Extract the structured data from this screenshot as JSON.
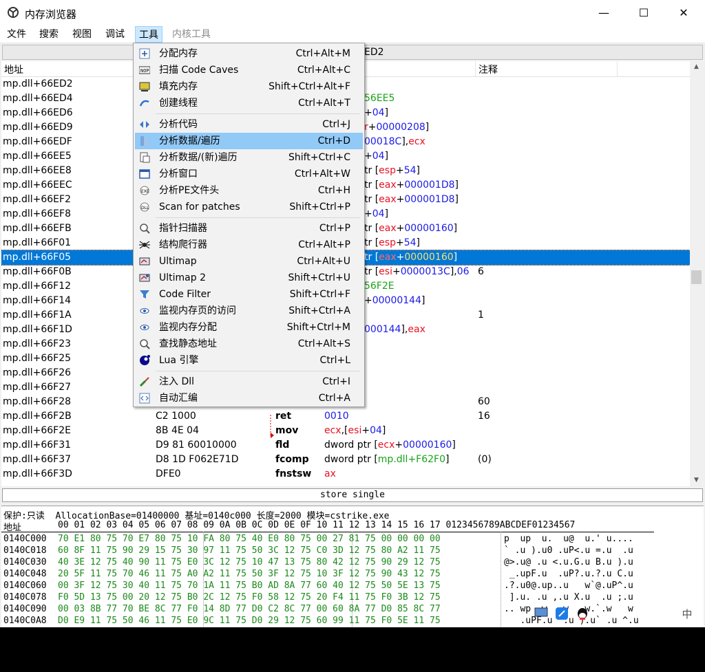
{
  "window": {
    "title": "内存浏览器",
    "buttons": {
      "minimize": "—",
      "maximize": "☐",
      "close": "✕"
    }
  },
  "menubar": [
    {
      "label": "文件"
    },
    {
      "label": "搜索"
    },
    {
      "label": "视图"
    },
    {
      "label": "调试"
    },
    {
      "label": "工具"
    },
    {
      "label": "内核工具"
    }
  ],
  "address_bar": {
    "value": "ED2"
  },
  "columns": {
    "address": "地址",
    "comment": "注释"
  },
  "disasm_rows": [
    {
      "addr": "mp.dll+66ED2"
    },
    {
      "addr": "mp.dll+66ED4",
      "operands": [
        {
          "t": "56EE5",
          "c": "sym"
        }
      ]
    },
    {
      "addr": "mp.dll+66ED6",
      "operands": [
        {
          "t": "+",
          "c": ""
        },
        {
          "t": "04",
          "c": "num"
        },
        {
          "t": "]",
          "c": ""
        }
      ]
    },
    {
      "addr": "mp.dll+66ED9",
      "operands": [
        {
          "t": "r",
          "c": "reg"
        },
        {
          "t": "+",
          "c": ""
        },
        {
          "t": "00000208",
          "c": "num"
        },
        {
          "t": "]",
          "c": ""
        }
      ]
    },
    {
      "addr": "mp.dll+66EDF",
      "operands": [
        {
          "t": "00018C",
          "c": "num"
        },
        {
          "t": "],",
          "c": ""
        },
        {
          "t": "ecx",
          "c": "reg"
        }
      ]
    },
    {
      "addr": "mp.dll+66EE5",
      "operands": [
        {
          "t": "+",
          "c": ""
        },
        {
          "t": "04",
          "c": "num"
        },
        {
          "t": "]",
          "c": ""
        }
      ]
    },
    {
      "addr": "mp.dll+66EE8",
      "operands": [
        {
          "t": "tr [",
          "c": ""
        },
        {
          "t": "esp",
          "c": "reg"
        },
        {
          "t": "+",
          "c": ""
        },
        {
          "t": "54",
          "c": "num"
        },
        {
          "t": "]",
          "c": ""
        }
      ]
    },
    {
      "addr": "mp.dll+66EEC",
      "operands": [
        {
          "t": "tr [",
          "c": ""
        },
        {
          "t": "eax",
          "c": "reg"
        },
        {
          "t": "+",
          "c": ""
        },
        {
          "t": "000001D8",
          "c": "num"
        },
        {
          "t": "]",
          "c": ""
        }
      ]
    },
    {
      "addr": "mp.dll+66EF2",
      "operands": [
        {
          "t": "tr [",
          "c": ""
        },
        {
          "t": "eax",
          "c": "reg"
        },
        {
          "t": "+",
          "c": ""
        },
        {
          "t": "000001D8",
          "c": "num"
        },
        {
          "t": "]",
          "c": ""
        }
      ]
    },
    {
      "addr": "mp.dll+66EF8",
      "operands": [
        {
          "t": "+",
          "c": ""
        },
        {
          "t": "04",
          "c": "num"
        },
        {
          "t": "]",
          "c": ""
        }
      ]
    },
    {
      "addr": "mp.dll+66EFB",
      "operands": [
        {
          "t": "tr [",
          "c": ""
        },
        {
          "t": "eax",
          "c": "reg"
        },
        {
          "t": "+",
          "c": ""
        },
        {
          "t": "00000160",
          "c": "num"
        },
        {
          "t": "]",
          "c": ""
        }
      ]
    },
    {
      "addr": "mp.dll+66F01",
      "operands": [
        {
          "t": "tr [",
          "c": ""
        },
        {
          "t": "esp",
          "c": "reg"
        },
        {
          "t": "+",
          "c": ""
        },
        {
          "t": "54",
          "c": "num"
        },
        {
          "t": "]",
          "c": ""
        }
      ]
    },
    {
      "addr": "mp.dll+66F05",
      "selected": true,
      "operands": [
        {
          "t": "tr [",
          "c": ""
        },
        {
          "t": "eax",
          "c": "reg"
        },
        {
          "t": "+",
          "c": ""
        },
        {
          "t": "00000160",
          "c": "num"
        },
        {
          "t": "]",
          "c": ""
        }
      ]
    },
    {
      "addr": "mp.dll+66F0B",
      "operands": [
        {
          "t": "tr [",
          "c": ""
        },
        {
          "t": "esi",
          "c": "reg"
        },
        {
          "t": "+",
          "c": ""
        },
        {
          "t": "0000013C",
          "c": "num"
        },
        {
          "t": "],",
          "c": ""
        },
        {
          "t": "06",
          "c": "num"
        }
      ],
      "comment": "6"
    },
    {
      "addr": "mp.dll+66F12",
      "operands": [
        {
          "t": "56F2E",
          "c": "sym"
        }
      ]
    },
    {
      "addr": "mp.dll+66F14",
      "operands": [
        {
          "t": "+",
          "c": ""
        },
        {
          "t": "00000144",
          "c": "num"
        },
        {
          "t": "]",
          "c": ""
        }
      ]
    },
    {
      "addr": "mp.dll+66F1A",
      "comment": "1"
    },
    {
      "addr": "mp.dll+66F1D",
      "operands": [
        {
          "t": "000144",
          "c": "num"
        },
        {
          "t": "],",
          "c": ""
        },
        {
          "t": "eax",
          "c": "reg"
        }
      ]
    },
    {
      "addr": "mp.dll+66F23"
    },
    {
      "addr": "mp.dll+66F25"
    },
    {
      "addr": "mp.dll+66F26"
    },
    {
      "addr": "mp.dll+66F27"
    },
    {
      "addr": "mp.dll+66F28",
      "comment": "60"
    },
    {
      "addr": "mp.dll+66F2B",
      "bytes": "C2 1000",
      "mnemonic": "ret",
      "operands": [
        {
          "t": "0010",
          "c": "num"
        }
      ],
      "comment": "16"
    },
    {
      "addr": "mp.dll+66F2E",
      "bytes": "8B 4E 04",
      "mnemonic": "mov",
      "operands": [
        {
          "t": "ecx",
          "c": "reg"
        },
        {
          "t": ",[",
          "c": ""
        },
        {
          "t": "esi",
          "c": "reg"
        },
        {
          "t": "+",
          "c": ""
        },
        {
          "t": "04",
          "c": "num"
        },
        {
          "t": "]",
          "c": ""
        }
      ]
    },
    {
      "addr": "mp.dll+66F31",
      "bytes": "D9 81 60010000",
      "mnemonic": "fld",
      "operands": [
        {
          "t": "dword ptr [",
          "c": ""
        },
        {
          "t": "ecx",
          "c": "reg"
        },
        {
          "t": "+",
          "c": ""
        },
        {
          "t": "00000160",
          "c": "num"
        },
        {
          "t": "]",
          "c": ""
        }
      ]
    },
    {
      "addr": "mp.dll+66F37",
      "bytes": "D8 1D F062E71D",
      "mnemonic": "fcomp",
      "operands": [
        {
          "t": "dword ptr [",
          "c": ""
        },
        {
          "t": "mp.dll+F62F0",
          "c": "sym"
        },
        {
          "t": "]",
          "c": ""
        }
      ],
      "comment": "(0)"
    },
    {
      "addr": "mp.dll+66F3D",
      "bytes": "DFE0",
      "mnemonic": "fnstsw",
      "operands": [
        {
          "t": "ax",
          "c": "reg"
        }
      ]
    }
  ],
  "status_box": "store single",
  "hex": {
    "info": "保护:只读  AllocationBase=01400000 基址=0140c000 长度=2000 模块=cstrike.exe",
    "header_addr": "地址",
    "header_cols": "00 01 02 03 04 05 06 07 08 09 0A 0B 0C 0D 0E 0F 10 11 12 13 14 15 16 17 0123456789ABCDEF01234567",
    "rows": [
      {
        "addr": "0140C000",
        "bytes": "70 E1 80 75 70 E7 80 75 10 FA 80 75 40 E0 80 75 00 27 81 75 00 00 00 00",
        "ascii": "p  up  u.  u@  u.' u...."
      },
      {
        "addr": "0140C018",
        "bytes": "60 8F 11 75 90 29 15 75 30 97 11 75 50 3C 12 75 C0 3D 12 75 80 A2 11 75",
        "ascii": "` .u ).u0 .uP<.u =.u  .u"
      },
      {
        "addr": "0140C030",
        "bytes": "40 3E 12 75 40 90 11 75 E0 3C 12 75 10 47 13 75 80 42 12 75 90 29 12 75",
        "ascii": "@>.u@ .u <.u.G.u B.u ).u"
      },
      {
        "addr": "0140C048",
        "bytes": "20 5F 11 75 70 46 11 75 A0 A2 11 75 50 3F 12 75 10 3F 12 75 90 43 12 75",
        "ascii": " _.upF.u  .uP?.u.?.u C.u"
      },
      {
        "addr": "0140C060",
        "bytes": "00 3F 12 75 30 40 11 75 70 1A 11 75 B0 AD 8A 77 60 40 12 75 50 5E 13 75",
        "ascii": ".?.u0@.up..u   w`@.uP^.u"
      },
      {
        "addr": "0140C078",
        "bytes": "F0 5D 13 75 00 20 12 75 B0 2C 12 75 F0 58 12 75 20 F4 11 75 F0 3B 12 75",
        "ascii": " ].u. .u ,.u X.u  .u ;.u"
      },
      {
        "addr": "0140C090",
        "bytes": "00 03 8B 77 70 BE 8C 77 F0 14 8D 77 D0 C2 8C 77 00 60 8A 77 D0 85 8C 77",
        "ascii": ".. wp  w   w   w.`.w   w"
      },
      {
        "addr": "0140C0A8",
        "bytes": "D0 E9 11 75 50 46 11 75 E0 9C 11 75 D0 29 12 75 60 99 11 75 F0 5E 11 75",
        "ascii": "   .uPF.u  .u ).u` .u ^.u"
      }
    ]
  },
  "tools_menu": {
    "items": [
      {
        "label": "分配内存",
        "shortcut": "Ctrl+Alt+M",
        "icon": "allocate-memory-icon"
      },
      {
        "label": "扫描 Code Caves",
        "shortcut": "Ctrl+Alt+C",
        "icon": "scan-caves-icon"
      },
      {
        "label": "填充内存",
        "shortcut": "Shift+Ctrl+Alt+F",
        "icon": "fill-memory-icon"
      },
      {
        "label": "创建线程",
        "shortcut": "Ctrl+Alt+T",
        "icon": "create-thread-icon"
      },
      {
        "sep": true
      },
      {
        "label": "分析代码",
        "shortcut": "Ctrl+J",
        "icon": "analyze-code-icon"
      },
      {
        "label": "分析数据/遍历",
        "shortcut": "Ctrl+D",
        "icon": "dissect-data-icon",
        "highlighted": true
      },
      {
        "label": "分析数据/(新)遍历",
        "shortcut": "Shift+Ctrl+C",
        "icon": "dissect-new-icon"
      },
      {
        "label": "分析窗口",
        "shortcut": "Ctrl+Alt+W",
        "icon": "dissect-window-icon"
      },
      {
        "label": "分析PE文件头",
        "shortcut": "Ctrl+H",
        "icon": "pe-header-icon"
      },
      {
        "label": "Scan for patches",
        "shortcut": "Shift+Ctrl+P",
        "icon": "scan-patches-icon"
      },
      {
        "sep": true
      },
      {
        "label": "指针扫描器",
        "shortcut": "Ctrl+P",
        "icon": "pointer-scanner-icon"
      },
      {
        "label": "结构爬行器",
        "shortcut": "Ctrl+Alt+P",
        "icon": "structure-spider-icon"
      },
      {
        "label": "Ultimap",
        "shortcut": "Ctrl+Alt+U",
        "icon": "ultimap-icon"
      },
      {
        "label": "Ultimap 2",
        "shortcut": "Shift+Ctrl+U",
        "icon": "ultimap2-icon"
      },
      {
        "label": "Code Filter",
        "shortcut": "Shift+Ctrl+F",
        "icon": "filter-icon"
      },
      {
        "label": "监视内存页的访问",
        "shortcut": "Shift+Ctrl+A",
        "icon": "eye-icon"
      },
      {
        "label": "监视内存分配",
        "shortcut": "Shift+Ctrl+M",
        "icon": "eye-alloc-icon"
      },
      {
        "label": "查找静态地址",
        "shortcut": "Ctrl+Alt+S",
        "icon": "static-address-icon"
      },
      {
        "label": "Lua 引擎",
        "shortcut": "Ctrl+L",
        "icon": "lua-icon"
      },
      {
        "sep": true
      },
      {
        "label": "注入 Dll",
        "shortcut": "Ctrl+I",
        "icon": "inject-dll-icon"
      },
      {
        "label": "自动汇编",
        "shortcut": "Ctrl+A",
        "icon": "auto-assemble-icon"
      }
    ]
  },
  "colors": {
    "selection": "#0078d7",
    "menu_highlight": "#91c9f7",
    "arrow": "#e8382f",
    "register": "#e81123",
    "number": "#1a1ae6",
    "symbol": "#19a319"
  }
}
